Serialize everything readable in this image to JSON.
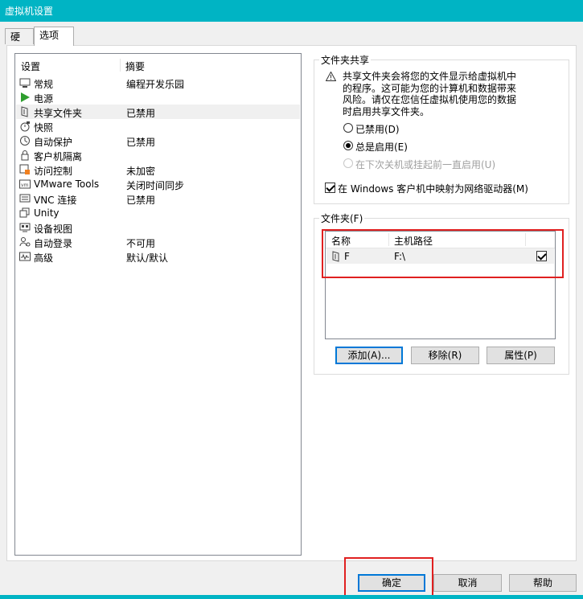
{
  "window": {
    "title": "虚拟机设置"
  },
  "tabs": [
    {
      "label": "硬件"
    },
    {
      "label": "选项"
    }
  ],
  "settings": {
    "header": {
      "setting": "设置",
      "summary": "摘要"
    },
    "items": [
      {
        "name": "常规",
        "summary": "编程开发乐园",
        "icon": "general-icon"
      },
      {
        "name": "电源",
        "summary": "",
        "icon": "power-play-icon"
      },
      {
        "name": "共享文件夹",
        "summary": "已禁用",
        "icon": "shared-folder-icon"
      },
      {
        "name": "快照",
        "summary": "",
        "icon": "snapshot-icon"
      },
      {
        "name": "自动保护",
        "summary": "已禁用",
        "icon": "autoprotect-icon"
      },
      {
        "name": "客户机隔离",
        "summary": "",
        "icon": "lock-icon"
      },
      {
        "name": "访问控制",
        "summary": "未加密",
        "icon": "access-control-icon"
      },
      {
        "name": "VMware Tools",
        "summary": "关闭时间同步",
        "icon": "vm-icon"
      },
      {
        "name": "VNC 连接",
        "summary": "已禁用",
        "icon": "vnc-icon"
      },
      {
        "name": "Unity",
        "summary": "",
        "icon": "unity-icon"
      },
      {
        "name": "设备视图",
        "summary": "",
        "icon": "device-view-icon"
      },
      {
        "name": "自动登录",
        "summary": "不可用",
        "icon": "autologin-icon"
      },
      {
        "name": "高级",
        "summary": "默认/默认",
        "icon": "advanced-icon"
      }
    ],
    "selected_index": 2
  },
  "folder_sharing": {
    "label": "文件夹共享",
    "warning_lines": [
      "共享文件夹会将您的文件显示给虚拟机中",
      "的程序。这可能为您的计算机和数据带来",
      "风险。请仅在您信任虚拟机使用您的数据",
      "时启用共享文件夹。"
    ],
    "options": [
      {
        "label": "已禁用(D)",
        "checked": false,
        "disabled": false
      },
      {
        "label": "总是启用(E)",
        "checked": true,
        "disabled": false
      },
      {
        "label": "在下次关机或挂起前一直启用(U)",
        "checked": false,
        "disabled": true
      }
    ],
    "map_drive": {
      "label": "在 Windows 客户机中映射为网络驱动器(M)",
      "checked": true
    }
  },
  "folders": {
    "label": "文件夹(F)",
    "columns": {
      "name": "名称",
      "host_path": "主机路径"
    },
    "rows": [
      {
        "name": "F",
        "host_path": "F:\\",
        "enabled": true
      }
    ],
    "buttons": {
      "add": "添加(A)...",
      "remove": "移除(R)",
      "properties": "属性(P)"
    }
  },
  "footer": {
    "ok": "确定",
    "cancel": "取消",
    "help": "帮助"
  },
  "colors": {
    "titlebar": "#00b4c4",
    "highlight": "#e02020",
    "play_green": "#2e9e2e"
  }
}
